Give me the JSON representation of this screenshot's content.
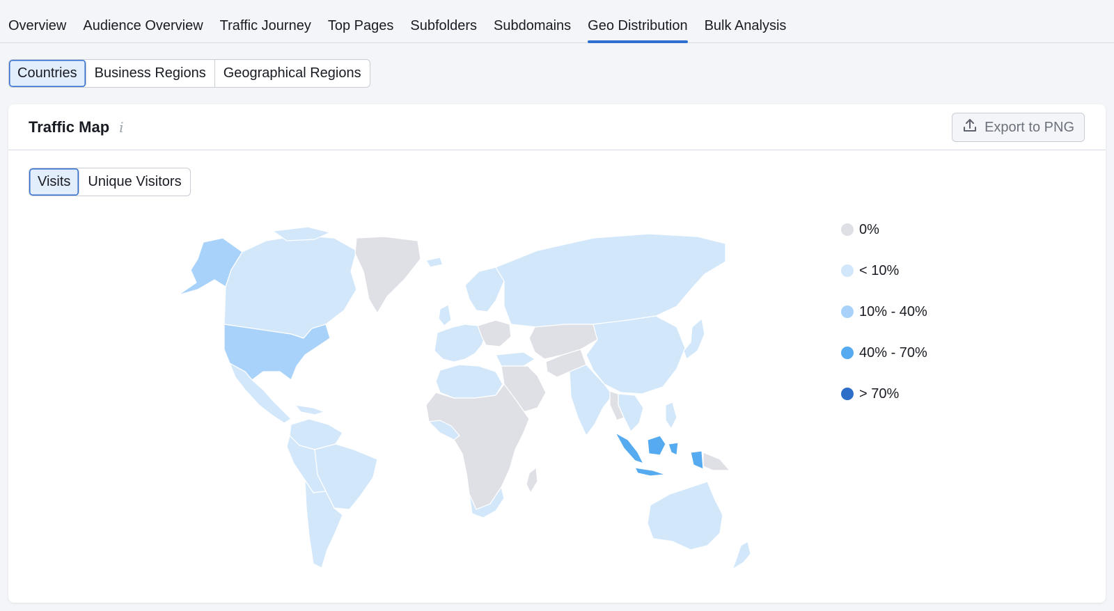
{
  "tabs": [
    {
      "label": "Overview",
      "active": false
    },
    {
      "label": "Audience Overview",
      "active": false
    },
    {
      "label": "Traffic Journey",
      "active": false
    },
    {
      "label": "Top Pages",
      "active": false
    },
    {
      "label": "Subfolders",
      "active": false
    },
    {
      "label": "Subdomains",
      "active": false
    },
    {
      "label": "Geo Distribution",
      "active": true
    },
    {
      "label": "Bulk Analysis",
      "active": false
    }
  ],
  "region_toggle": {
    "options": [
      "Countries",
      "Business Regions",
      "Geographical Regions"
    ],
    "selected": "Countries"
  },
  "card": {
    "title": "Traffic Map",
    "info_icon": "info-icon",
    "export_label": "Export to PNG",
    "export_icon": "upload-icon"
  },
  "metric_toggle": {
    "options": [
      "Visits",
      "Unique Visitors"
    ],
    "selected": "Visits"
  },
  "legend": [
    {
      "label": "0%",
      "color": "#dfe0e6"
    },
    {
      "label": "< 10%",
      "color": "#d3e7fb"
    },
    {
      "label": "10% - 40%",
      "color": "#a9d2fb"
    },
    {
      "label": "40% - 70%",
      "color": "#56aaf0"
    },
    {
      "label": "> 70%",
      "color": "#2d6ec8"
    }
  ],
  "colors": {
    "accent": "#2e6fcf",
    "none": "#dfe0e6",
    "low": "#d3e7fb",
    "mid": "#a9d2fb",
    "high": "#56aaf0"
  }
}
